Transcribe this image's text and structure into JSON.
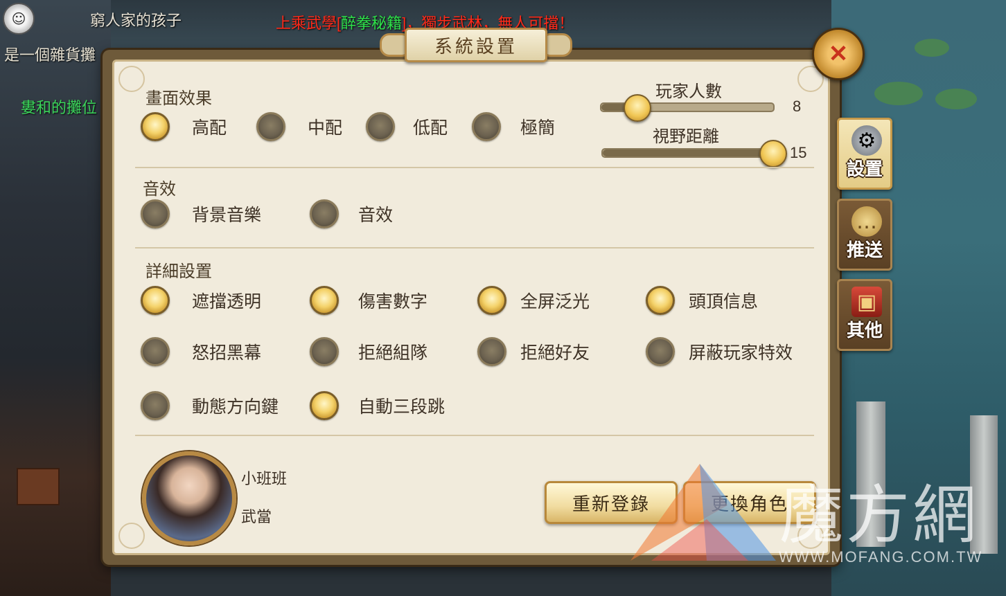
{
  "hud": {
    "player_name": "窮人家的孩子",
    "news_prefix": "上乘武學[",
    "news_item": "醉拳秘籍",
    "news_suffix": "]，獨步武林，無人可擋！",
    "npc_label_1": "是一個雜貨攤",
    "npc_label_2": "婁和的攤位"
  },
  "dialog": {
    "title": "系統設置",
    "close_icon": "close-x-icon",
    "graphics": {
      "label": "畫面效果",
      "options": [
        {
          "label": "高配",
          "selected": true
        },
        {
          "label": "中配",
          "selected": false
        },
        {
          "label": "低配",
          "selected": false
        },
        {
          "label": "極簡",
          "selected": false
        }
      ]
    },
    "sliders": {
      "players": {
        "label": "玩家人數",
        "value": "8",
        "fraction": 0.2
      },
      "view": {
        "label": "視野距離",
        "value": "15",
        "fraction": 1.0
      }
    },
    "sound": {
      "label": "音效",
      "options": [
        {
          "label": "背景音樂",
          "selected": false
        },
        {
          "label": "音效",
          "selected": false
        }
      ]
    },
    "detail": {
      "label": "詳細設置",
      "options": [
        {
          "label": "遮擋透明",
          "selected": true
        },
        {
          "label": "傷害數字",
          "selected": true
        },
        {
          "label": "全屏泛光",
          "selected": true
        },
        {
          "label": "頭頂信息",
          "selected": true
        },
        {
          "label": "怒招黑幕",
          "selected": false
        },
        {
          "label": "拒絕組隊",
          "selected": false
        },
        {
          "label": "拒絕好友",
          "selected": false
        },
        {
          "label": "屏蔽玩家特效",
          "selected": false
        },
        {
          "label": "動態方向鍵",
          "selected": false
        },
        {
          "label": "自動三段跳",
          "selected": true
        }
      ]
    },
    "character": {
      "name": "小班班",
      "school": "武當"
    },
    "buttons": {
      "relogin": "重新登錄",
      "change_role": "更換角色"
    }
  },
  "side_tabs": [
    {
      "label": "設置",
      "icon": "gear-icon",
      "active": true
    },
    {
      "label": "推送",
      "icon": "chat-bubble-icon",
      "active": false
    },
    {
      "label": "其他",
      "icon": "treasure-chest-icon",
      "active": false
    }
  ],
  "watermark": {
    "text": "魔方網",
    "url": "WWW.MOFANG.COM.TW"
  }
}
